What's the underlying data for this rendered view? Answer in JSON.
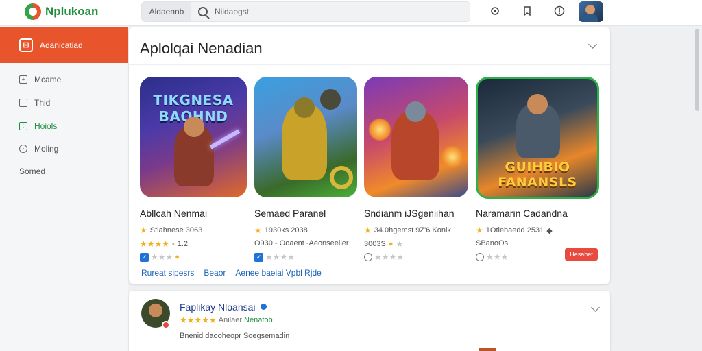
{
  "header": {
    "logo_text": "Nplukoan",
    "search_category": "Aldaennb",
    "search_placeholder": "Niidaogst"
  },
  "sidebar": {
    "active_label": "Adanicatiad",
    "items": [
      {
        "label": "Mcame",
        "icon": "grid-icon"
      },
      {
        "label": "Thid",
        "icon": "page-icon"
      },
      {
        "label": "Hoiols",
        "icon": "folder-icon"
      },
      {
        "label": "Moling",
        "icon": "clock-icon"
      },
      {
        "label": "Somed",
        "icon": ""
      }
    ]
  },
  "section": {
    "title": "Aplolqai Nenadian",
    "apps": [
      {
        "name": "Abllcah Nenmai",
        "art_title": "TIKGNESA BAOHND",
        "line1": "Stiahnese 3063",
        "line2": "1.2",
        "line3": ""
      },
      {
        "name": "Semaed Paranel",
        "art_title": "",
        "line1": "1930ks 2038",
        "line2": "O930 - Ooaent -Aeonseelier",
        "line3": ""
      },
      {
        "name": "Sndianm iJSgeniihan",
        "art_title": "",
        "line1": "34.0hgemst 9Z'6 Konlk",
        "line2": "3003S",
        "line3": ""
      },
      {
        "name": "Naramarin Cadandna",
        "art_title": "GUIHBIO FANANSLS",
        "line1": "1Otlehaedd 2531",
        "line2": "SBanoOs",
        "line3": ""
      }
    ],
    "badge": "Hesahet",
    "links": [
      "Rureat sipesrs",
      "Beaor",
      "Aenee baeiai Vpbl Rjde"
    ]
  },
  "review": {
    "name": "Faplikay Nloansai",
    "rating_text": "Anilaer",
    "tag": "Nenatob",
    "text": "Bnenid daooheopr Soegsemadin"
  },
  "colors": {
    "accent": "#e8542b",
    "brand_green": "#1f8f3d",
    "link": "#1e63b8",
    "star": "#f2b01e"
  }
}
